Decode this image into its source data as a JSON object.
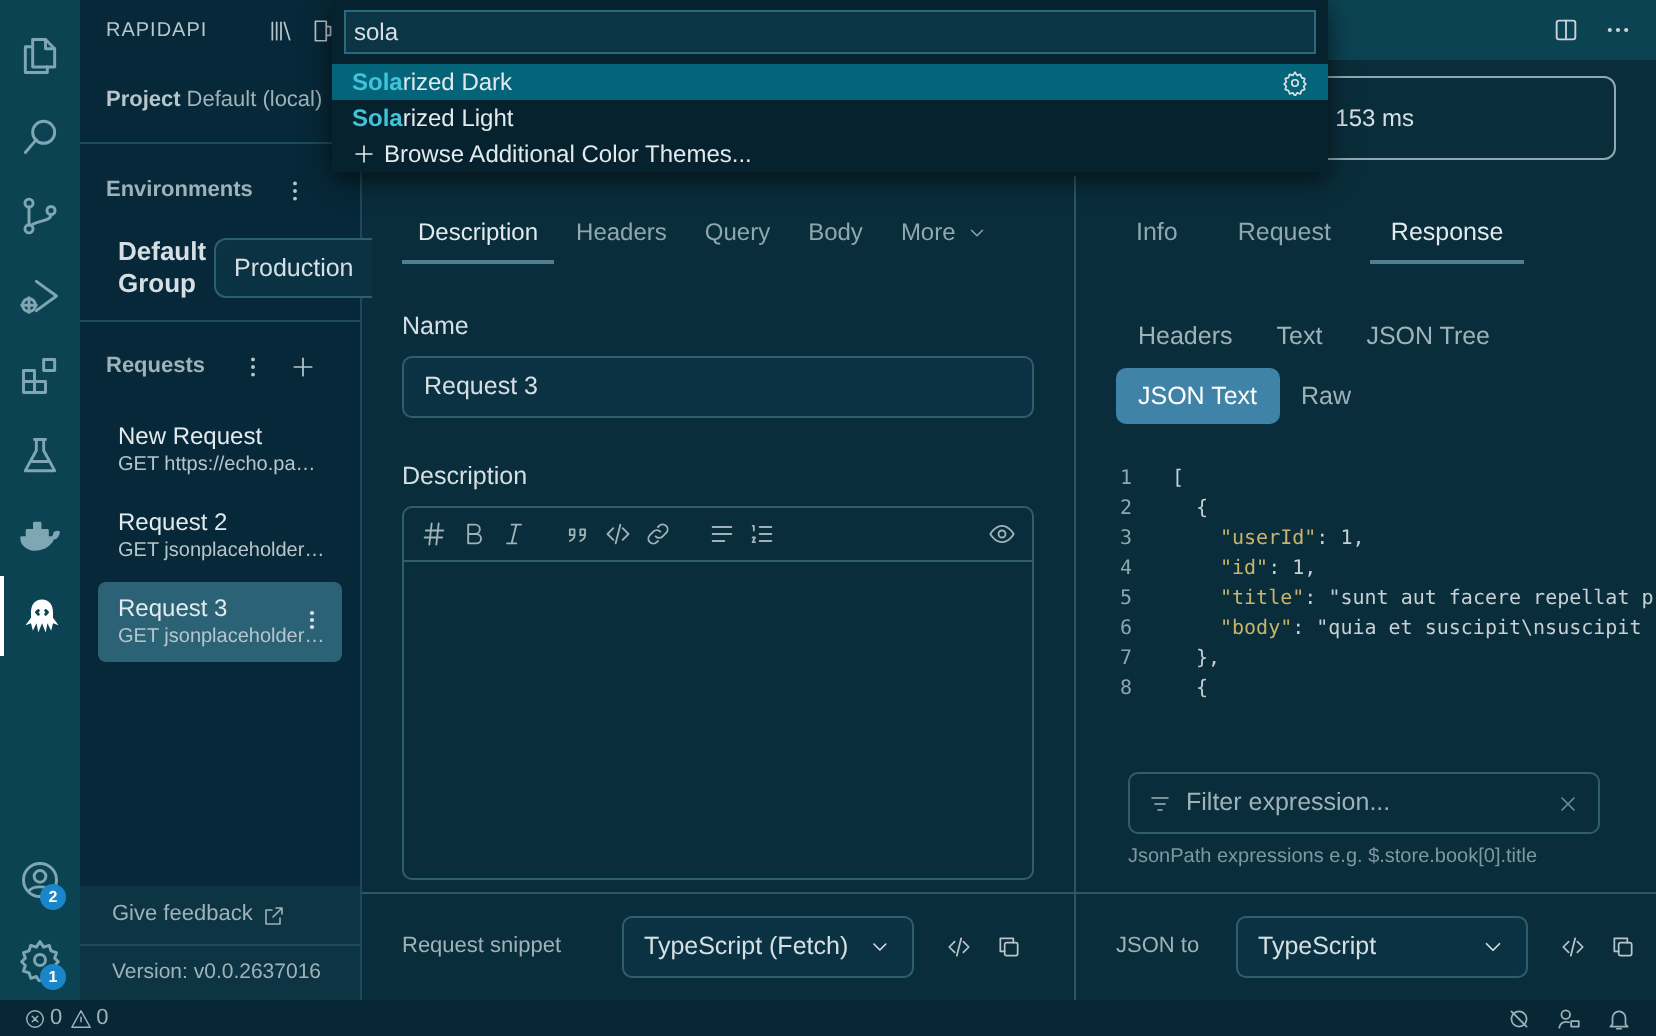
{
  "activity_bar": {
    "items": [
      {
        "kind": "files",
        "selected": false
      },
      {
        "kind": "search",
        "selected": false
      },
      {
        "kind": "source-control",
        "selected": false
      },
      {
        "kind": "run-debug",
        "selected": false
      },
      {
        "kind": "extensions",
        "selected": false
      },
      {
        "kind": "testing",
        "selected": false
      },
      {
        "kind": "docker",
        "selected": false
      },
      {
        "kind": "octopus",
        "selected": true
      }
    ],
    "bottom": [
      {
        "kind": "account",
        "badge": "2"
      },
      {
        "kind": "settings",
        "badge": "1"
      }
    ]
  },
  "sidebar": {
    "title": "RAPIDAPI",
    "project": {
      "label": "Project",
      "value": "Default (local)"
    },
    "environments": {
      "title": "Environments",
      "group": "Default Group",
      "environment": "Production"
    },
    "requests": {
      "title": "Requests",
      "items": [
        {
          "name": "New Request",
          "url": "GET https://echo.pa…",
          "selected": false
        },
        {
          "name": "Request 2",
          "url": "GET jsonplaceholder…",
          "selected": false
        },
        {
          "name": "Request 3",
          "url": "GET jsonplaceholder…",
          "selected": true
        }
      ]
    },
    "feedback": "Give feedback",
    "version": "Version: v0.0.2637016"
  },
  "quick_pick": {
    "value": "sola",
    "items": [
      {
        "match": "Sola",
        "rest": "rized Dark",
        "selected": true
      },
      {
        "match": "Sola",
        "rest": "rized Light",
        "selected": false
      }
    ],
    "action": "Browse Additional Color Themes..."
  },
  "request_bar": {
    "time": "153 ms"
  },
  "editor": {
    "tabs": [
      {
        "label": "Description",
        "selected": true
      },
      {
        "label": "Headers",
        "selected": false
      },
      {
        "label": "Query",
        "selected": false
      },
      {
        "label": "Body",
        "selected": false
      },
      {
        "label": "More",
        "selected": false
      }
    ],
    "name_label": "Name",
    "name_value": "Request 3",
    "description_label": "Description",
    "snippet_label": "Request snippet",
    "snippet_language": "TypeScript (Fetch)"
  },
  "response": {
    "tabs": [
      {
        "label": "Info",
        "selected": false
      },
      {
        "label": "Request",
        "selected": false
      },
      {
        "label": "Response",
        "selected": true
      }
    ],
    "view_tabs": [
      {
        "label": "Headers",
        "selected": false
      },
      {
        "label": "Text",
        "selected": false
      },
      {
        "label": "JSON Tree",
        "selected": false
      },
      {
        "label": "JSON Text",
        "selected": true
      },
      {
        "label": "Raw",
        "selected": false
      }
    ],
    "code_lines": [
      {
        "number": "1",
        "kind": "plain",
        "text": "["
      },
      {
        "number": "2",
        "kind": "plain",
        "text": "  {"
      },
      {
        "number": "3",
        "kind": "pair",
        "key": "\"userId\"",
        "rest": ": 1,"
      },
      {
        "number": "4",
        "kind": "pair",
        "key": "\"id\"",
        "rest": ": 1,"
      },
      {
        "number": "5",
        "kind": "pair",
        "key": "\"title\"",
        "rest": ": \"sunt aut facere repellat p"
      },
      {
        "number": "6",
        "kind": "pair",
        "key": "\"body\"",
        "rest": ": \"quia et suscipit\\nsuscipit"
      },
      {
        "number": "7",
        "kind": "plain",
        "text": "  },"
      },
      {
        "number": "8",
        "kind": "plain",
        "text": "  {"
      }
    ],
    "filter_placeholder": "Filter expression...",
    "filter_hint": "JsonPath expressions e.g. $.store.book[0].title",
    "convert_label": "JSON to",
    "convert_language": "TypeScript"
  },
  "status_bar": {
    "errors": "0",
    "warnings": "0"
  }
}
